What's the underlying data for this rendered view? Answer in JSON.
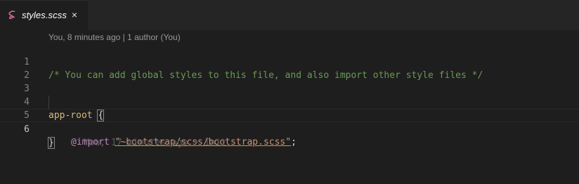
{
  "tab": {
    "label": "styles.scss",
    "icon": "sass-icon",
    "close": "×"
  },
  "codelens": {
    "text": "You, 8 minutes ago | 1 author (You)"
  },
  "lines": [
    {
      "number": "1",
      "parts": [
        "/* You can add global styles to this file, and also import other style files */"
      ]
    },
    {
      "number": "2",
      "parts": []
    },
    {
      "number": "3",
      "parts": []
    },
    {
      "number": "4",
      "parts": [
        "app-root",
        " ",
        "{"
      ]
    },
    {
      "number": "5",
      "parts": [
        "@import",
        " ",
        "\"~bootstrap/scss/bootstrap.scss\"",
        ";"
      ]
    },
    {
      "number": "6",
      "parts": [
        "}"
      ],
      "blame": "You, 17 minutes ago • Init"
    }
  ],
  "colors": {
    "background": "#1e1e1e",
    "comment": "#6a9955",
    "selector": "#d7ba7d",
    "keyword": "#c586c0",
    "string": "#ce9178",
    "sass": "#cd6799"
  }
}
